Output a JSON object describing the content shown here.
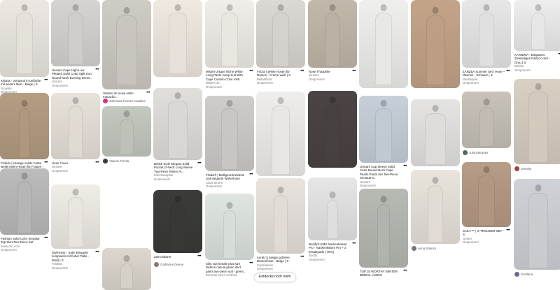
{
  "more_ideas_button": "Entdecke noch mehr",
  "more_glyph": "•••",
  "columns": [
    [
      {
        "title": "Xylana - Jumpsuit in Unifarbe mit weitem Bein - Beige | S",
        "sub": "Soxyele",
        "status": "Gesponsert",
        "tone": "#ece8e1"
      },
      {
        "title": "Frislido | Lässige solide Farbe weiten Bein Hosen für Frauen - S",
        "sub": "Frandaro",
        "status": "Gesponsert",
        "tone": "#b59d82"
      },
      {
        "title": "Fashion Solid Color Irregular Top Skirt Two-Piece Set",
        "sub": "Jeescorn.com",
        "status": "Gesponsert",
        "tone": "#bcbcbc"
      }
    ],
    [
      {
        "title": "Unicam Cape High-Low Pleated Solid Color Split Icon Round-Neck Evening Dress...",
        "sub": "Unicam",
        "status": "Gesponsert",
        "tone": "#d6d4d1"
      },
      {
        "title": "Hose Cover",
        "sub": "Sezane",
        "status": "Gesponsert",
        "tone": "#e7e2da"
      },
      {
        "title": "StyleSexy - Satin Elegante Jumpsuits mit hoher Taille - Weiß | S",
        "sub": "Yolditas",
        "status": "Gesponsert",
        "tone": "#f0ece6"
      }
    ],
    [
      {
        "title": "Vestido de noiva estilo macacão...",
        "user": "Sollerana Fonrari Casaline",
        "tone": "#cfcbc5",
        "avatar": "#c83a8c"
      },
      {
        "title": "",
        "user": "Yasmin Fizzita",
        "tone": "#c4c9c0",
        "avatar": "#3a3a3a"
      },
      {
        "title": "",
        "tone": "#ddd7cf"
      }
    ],
    [
      {
        "title": "",
        "tone": "#efe9e1"
      },
      {
        "title": "British Style Elegant Solid Pocket O-Neck Long Sleeve Two-Piece Winter Al...",
        "sub": "bohemianplus",
        "status": "Gesponsert",
        "tone": "#e1dfdc"
      },
      {
        "title": "Zaino Blazer",
        "user": "Catharine Deene",
        "tone": "#3b3c3a",
        "avatar": "#8a7a6a"
      }
    ],
    [
      {
        "title": "Misbel Unique Niche White Long Pants Jump Suit With Cape Custom Color AKB",
        "sub": "Misbel UK",
        "status": "Gesponsert",
        "tone": "#f1eee9"
      },
      {
        "title": "Thalia® | Maßgeschneiderte und elegante Winterhose",
        "sub": "Clara Moore",
        "status": "Gesponsert",
        "tone": "#cfcdca"
      },
      {
        "title": "Slim suit female plus size fashion casual green shirt pants two-piece suit - green...",
        "sub": "Sommer Seen Clothes",
        "status": "",
        "tone": "#dfe5e0"
      }
    ],
    [
      {
        "title": "Fritzia | Weite Hosen für Damen - Creme weiß | S",
        "sub": "Bellarifisha",
        "status": "Gesponsert",
        "tone": "#dcd9d4"
      },
      {
        "title": "",
        "tone": "#f0eeec"
      },
      {
        "title": "Aureli | Lässige goldene Damenhose - Beige | S",
        "sub": "Sophiabelin",
        "status": "Gesponsert",
        "tone": "#e8e3dc"
      }
    ],
    [
      {
        "title": "Nose Thaophile",
        "sub": "Sezane",
        "status": "Gesponsert",
        "tone": "#c2b8aa"
      },
      {
        "title": "",
        "tone": "#4a4444"
      },
      {
        "title": "Bodify® EMS Nackenkissen Pro - Nackenkissen Pro + 2 Ersatzpads (-30%)",
        "sub": "Bodify",
        "status": "Gesponsert",
        "tone": "#e6e6e6"
      }
    ],
    [
      {
        "title": "",
        "tone": "#efefee"
      },
      {
        "title": "Unicam Cap Sleeve Solid Color Round-Neck Cape Pearls Pants Set Two-Piece Set BLB-G",
        "sub": "Unicam",
        "status": "Gesponsert",
        "tone": "#c7d0da"
      },
      {
        "title": "TOP 25 WORTHY WINTER BRIDAL LOOKS",
        "tone": "#b7bab4"
      }
    ],
    [
      {
        "title": "",
        "tone": "#c4a489"
      },
      {
        "title": "",
        "tone": "#e5e4e3"
      },
      {
        "title": "",
        "user": "Anna Stalnim",
        "tone": "#e9e4dc",
        "avatar": "#777777"
      }
    ],
    [
      {
        "title": "ZANZEA Summer Set | Hose + Oberteil - Schwarz | S",
        "sub": "Modelayhe",
        "status": "Gesponsert",
        "tone": "#e7e7e7"
      },
      {
        "title": "",
        "user": "Julia Marques",
        "tone": "#c8c2b8",
        "avatar": "#4a6a5a"
      },
      {
        "title": "SAILY™ | O-TROUSER SET - S",
        "sub": "Oyaen",
        "status": "Gesponsert",
        "tone": "#b79c86"
      }
    ],
    [
      {
        "title": "KARNIMA - Elegantes Zweiteiliges Palazzo-Set - Grau | S",
        "sub": "Bellaiz",
        "status": "Gesponsert",
        "tone": "#eeeeee"
      },
      {
        "title": "",
        "user": "nemelty",
        "tone": "#d9d0c4",
        "avatar": "#a04040"
      },
      {
        "title": "",
        "user": "Svetlana",
        "tone": "#cfd2d6",
        "avatar": "#6a6a8a"
      }
    ]
  ]
}
